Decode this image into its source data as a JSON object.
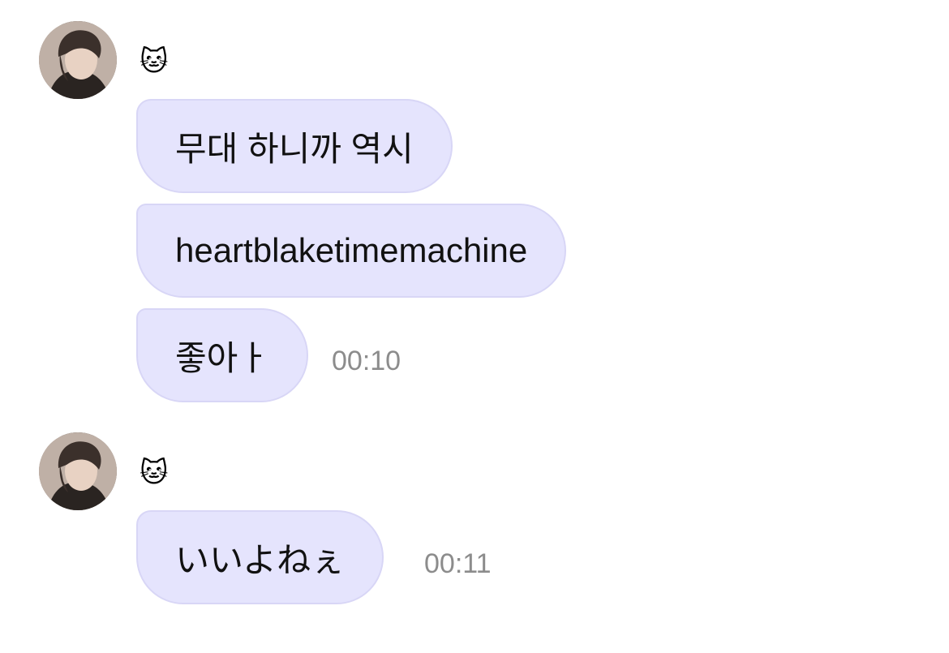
{
  "groups": [
    {
      "sender": "🐱",
      "messages": [
        {
          "text": "무대 하니까 역시"
        },
        {
          "text": "heartblaketimemachine"
        },
        {
          "text": "좋아ㅏ"
        }
      ],
      "time": "00:10"
    },
    {
      "sender": "🐱",
      "messages": [
        {
          "text": "いいよねぇ"
        }
      ],
      "time": "00:11"
    }
  ],
  "colors": {
    "bubble_bg": "#e5e4fd",
    "bubble_border": "#d8d6f6",
    "time_text": "#8c8c8c"
  }
}
